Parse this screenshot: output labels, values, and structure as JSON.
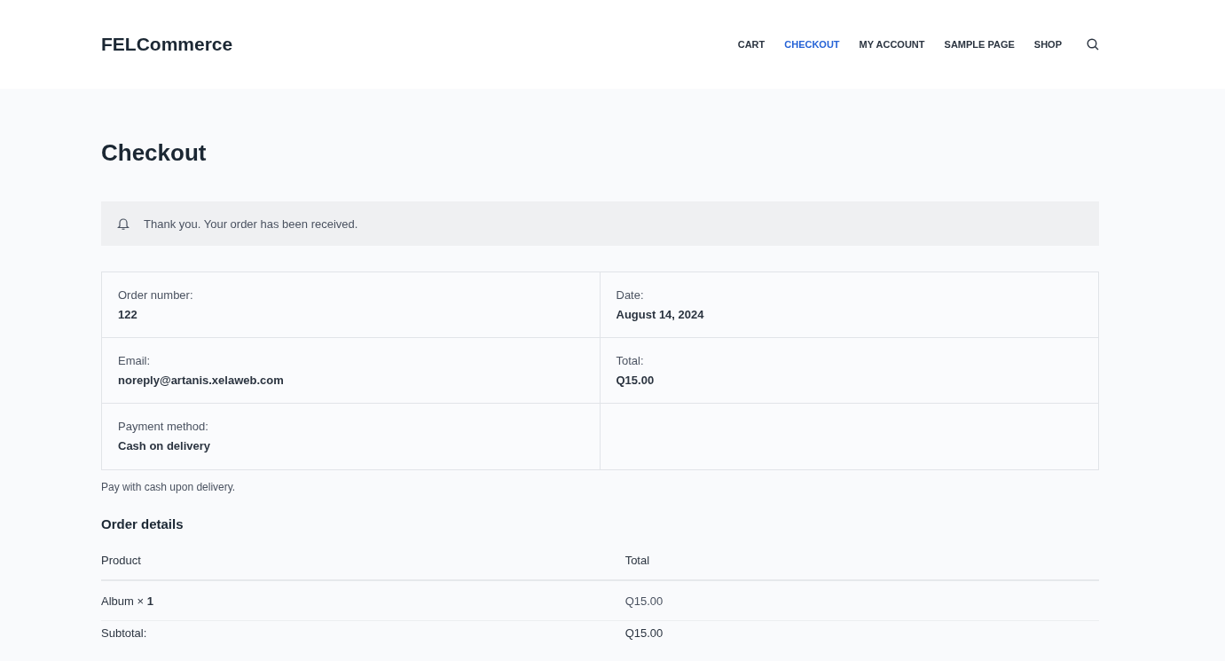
{
  "site_title": "FELCommerce",
  "nav": [
    {
      "label": "CART",
      "selected": false
    },
    {
      "label": "CHECKOUT",
      "selected": true
    },
    {
      "label": "MY ACCOUNT",
      "selected": false
    },
    {
      "label": "SAMPLE PAGE",
      "selected": false
    },
    {
      "label": "SHOP",
      "selected": false
    }
  ],
  "page_title": "Checkout",
  "notice": "Thank you. Your order has been received.",
  "overview": [
    {
      "label": "Order number:",
      "value": "122"
    },
    {
      "label": "Date:",
      "value": "August 14, 2024"
    },
    {
      "label": "Email:",
      "value": "noreply@artanis.xelaweb.com"
    },
    {
      "label": "Total:",
      "value": "Q15.00"
    },
    {
      "label": "Payment method:",
      "value": "Cash on delivery"
    }
  ],
  "payment_note": "Pay with cash upon delivery.",
  "order_details": {
    "title": "Order details",
    "columns": [
      "Product",
      "Total"
    ],
    "rows": [
      {
        "kind": "item",
        "product": "Album × **1**",
        "total": "Q15.00"
      },
      {
        "kind": "summary",
        "product": "Subtotal:",
        "total": "Q15.00"
      }
    ]
  }
}
